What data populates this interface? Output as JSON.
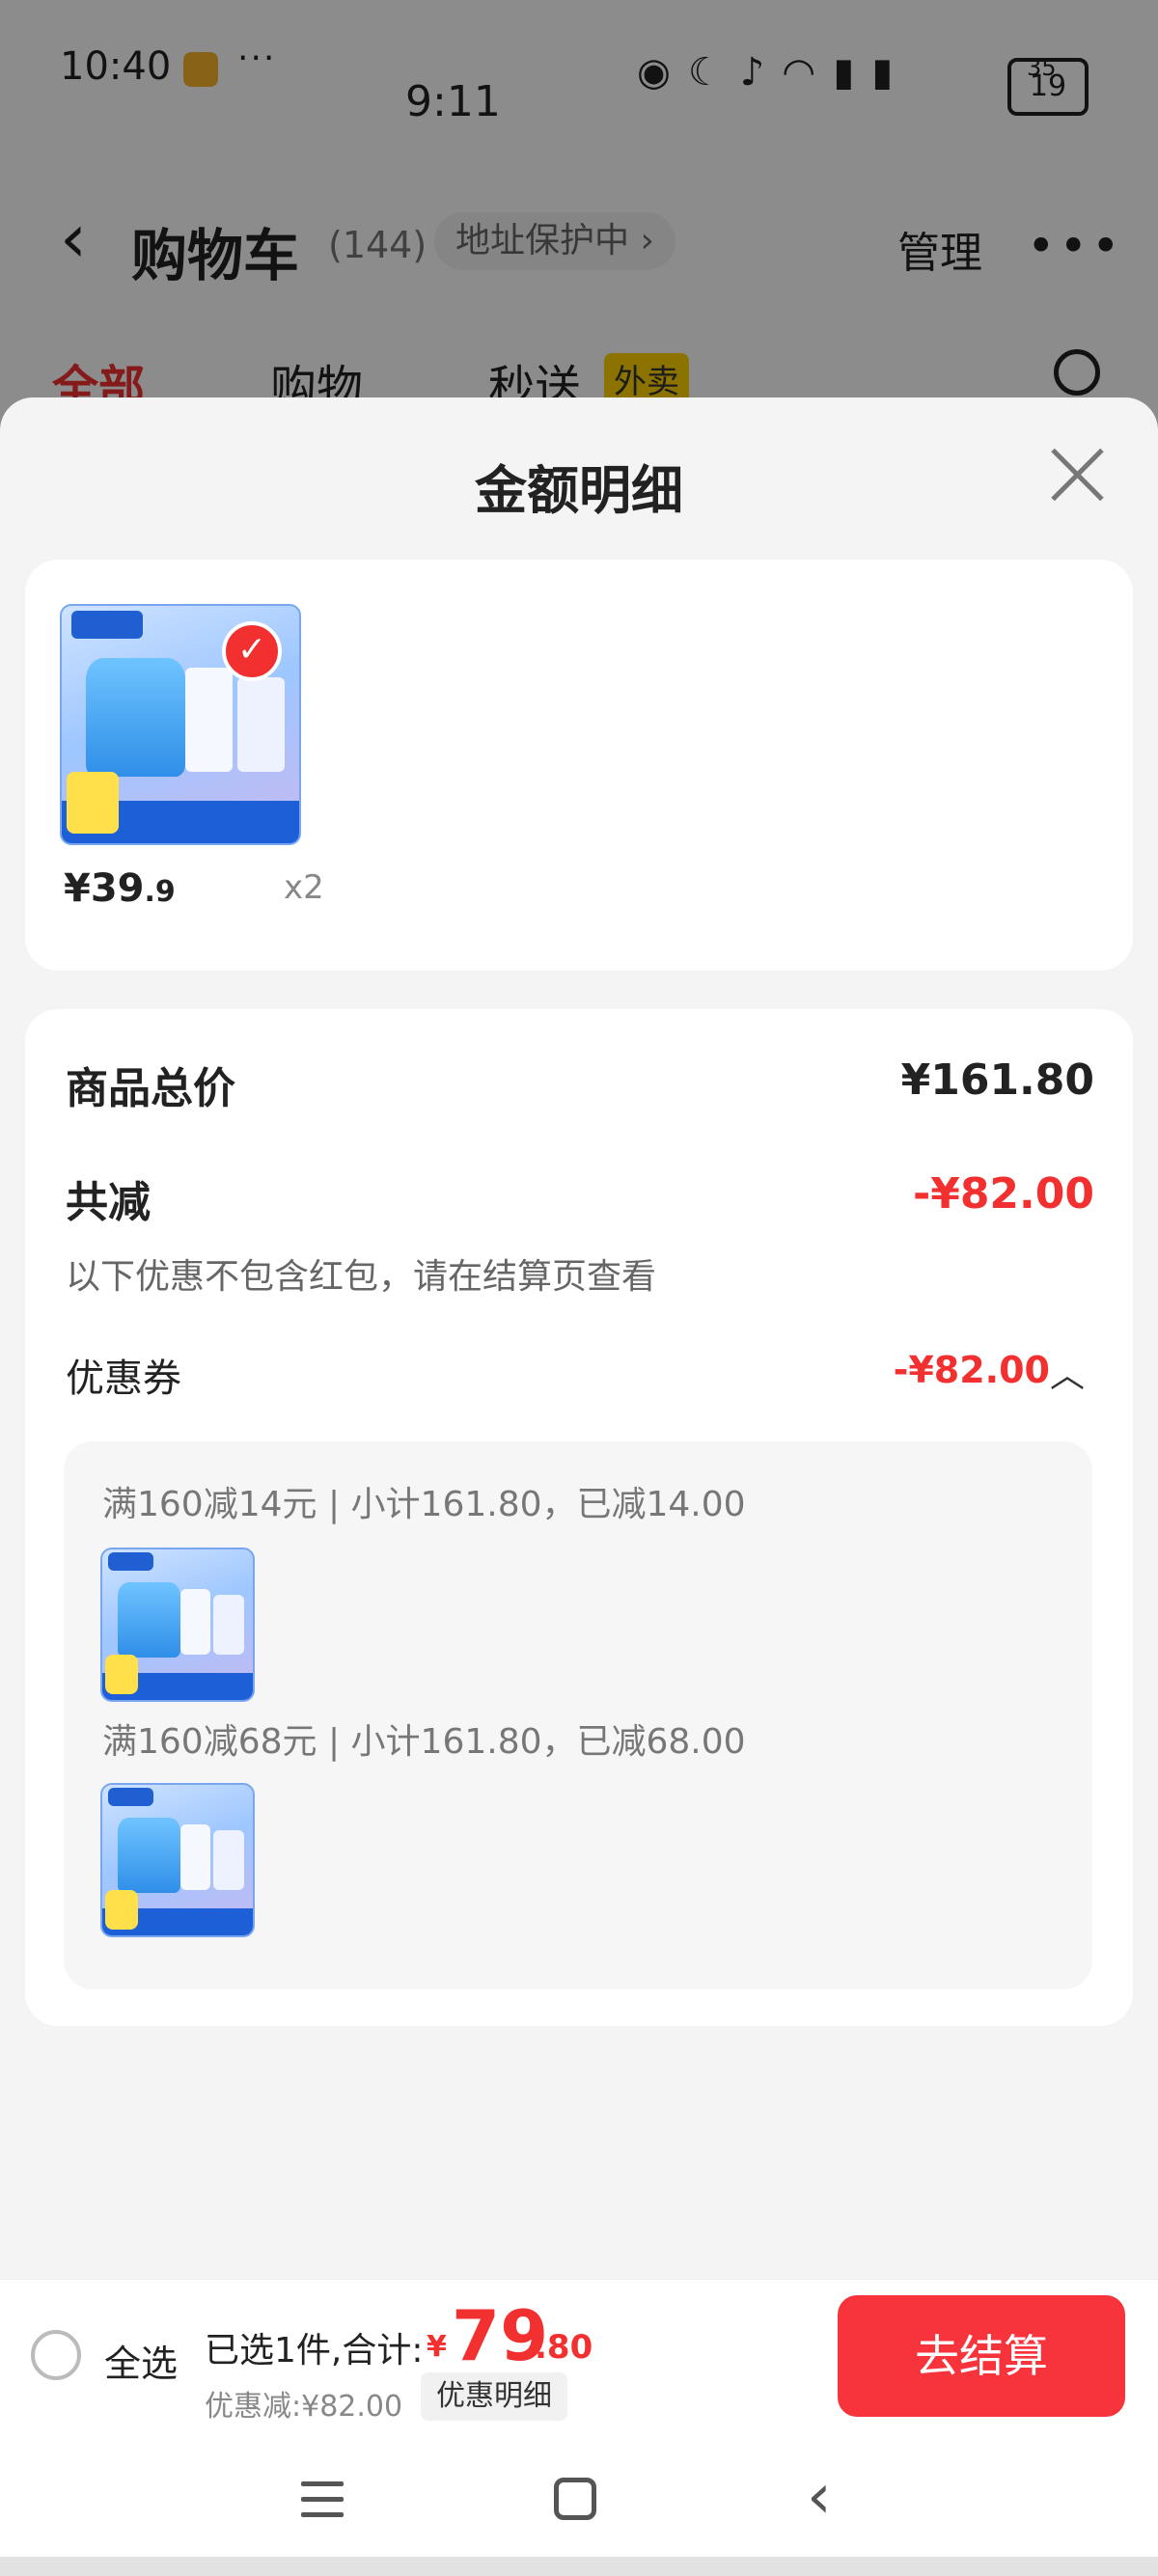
{
  "status_bar": {
    "time_left": "10:40",
    "dots": "···",
    "time_center": "9:11",
    "battery_top": "35",
    "battery": "19"
  },
  "cart_header": {
    "back_icon": "chevron-left-icon",
    "title": "购物车",
    "count": "(144)",
    "address": "地址保护中 ›",
    "manage": "管理"
  },
  "tabs": [
    {
      "label": "全部"
    },
    {
      "label": "购物"
    },
    {
      "label": "秒送"
    }
  ],
  "tab_badge": "外卖",
  "sheet": {
    "title": "金额明细"
  },
  "product": {
    "price_int": "¥39",
    "price_dec": ".9",
    "qty": "x2"
  },
  "detail": {
    "total_label": "商品总价",
    "total_value": "¥161.80",
    "reduce_label": "共减",
    "reduce_value": "-¥82.00",
    "note": "以下优惠不包含红包，请在结算页查看",
    "coupon_label": "优惠券",
    "coupon_value": "-¥82.00",
    "coupons": [
      "满160减14元 | 小计161.80，已减14.00",
      "满160减68元 | 小计161.80，已减68.00"
    ]
  },
  "checkout": {
    "select_all": "全选",
    "selected": "已选1件,合计:",
    "currency": "¥",
    "sum_int": "79",
    "sum_dec": ".80",
    "discount": "优惠减:¥82.00",
    "detail_chip": "优惠明细",
    "button": "去结算"
  },
  "colors": {
    "accent_red": "#f23030",
    "button_red": "#f7333c",
    "badge_yellow": "#ffd100"
  }
}
